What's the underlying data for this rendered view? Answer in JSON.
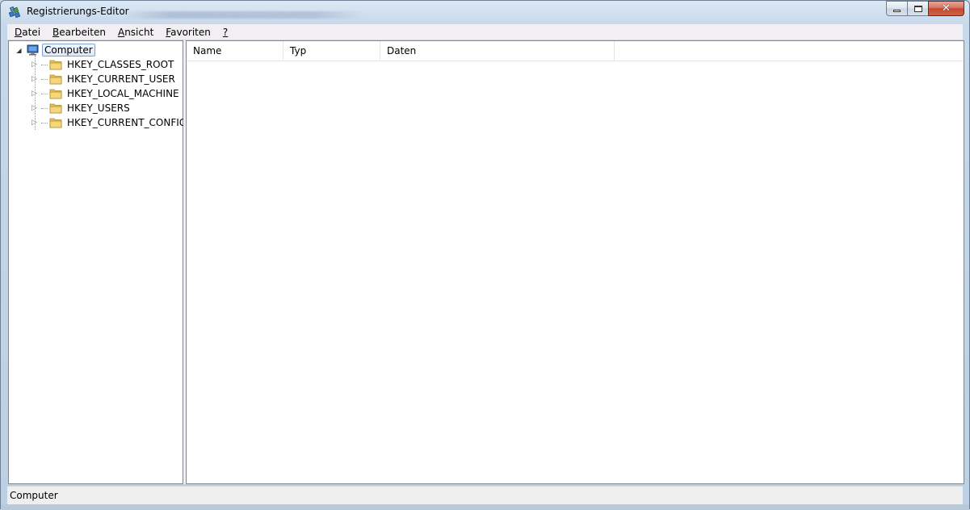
{
  "window": {
    "title": "Registrierungs-Editor",
    "icon": "registry-editor-icon"
  },
  "caption": {
    "minimize_icon": "minimize-icon",
    "maximize_icon": "maximize-icon",
    "close_icon": "close-icon",
    "close_glyph": "✕"
  },
  "menu": {
    "items": [
      {
        "underline": "D",
        "rest": "atei"
      },
      {
        "underline": "B",
        "rest": "earbeiten"
      },
      {
        "underline": "A",
        "rest": "nsicht"
      },
      {
        "underline": "F",
        "rest": "avoriten"
      },
      {
        "underline": "?",
        "rest": ""
      }
    ]
  },
  "tree": {
    "root": {
      "label": "Computer",
      "expanded_glyph": "◢",
      "icon": "computer-icon"
    },
    "children": [
      {
        "label": "HKEY_CLASSES_ROOT",
        "glyph": "▷",
        "icon": "folder-icon"
      },
      {
        "label": "HKEY_CURRENT_USER",
        "glyph": "▷",
        "icon": "folder-icon"
      },
      {
        "label": "HKEY_LOCAL_MACHINE",
        "glyph": "▷",
        "icon": "folder-icon"
      },
      {
        "label": "HKEY_USERS",
        "glyph": "▷",
        "icon": "folder-icon"
      },
      {
        "label": "HKEY_CURRENT_CONFIG",
        "glyph": "▷",
        "icon": "folder-icon"
      }
    ]
  },
  "list": {
    "columns": [
      "Name",
      "Typ",
      "Daten"
    ]
  },
  "status": {
    "text": "Computer"
  },
  "colors": {
    "selection_border": "#7da2ce",
    "close_button": "#c44a33",
    "folder": "#e8c35a"
  }
}
